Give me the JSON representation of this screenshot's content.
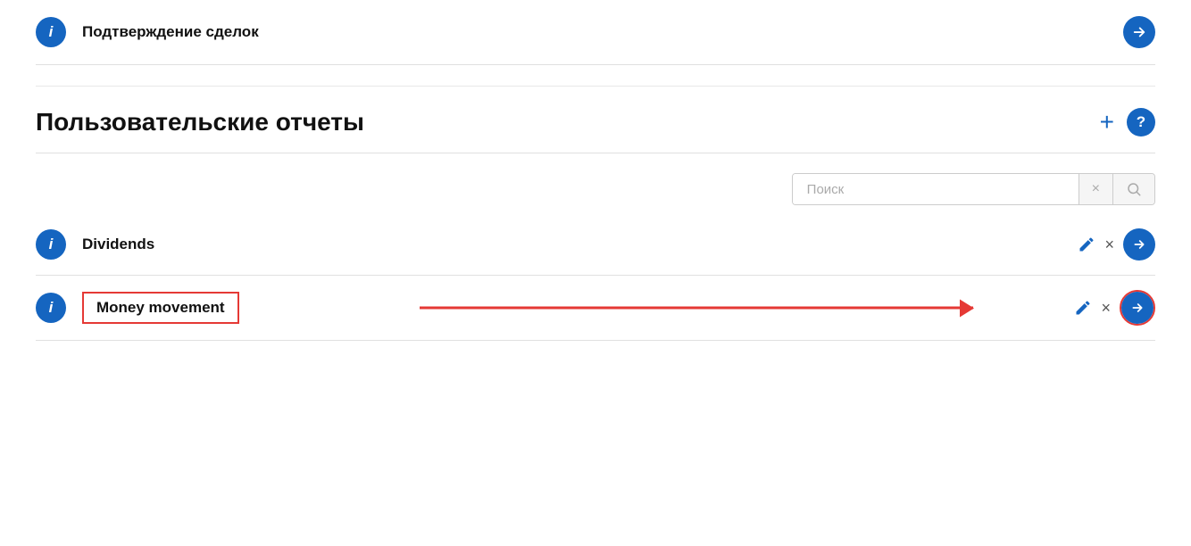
{
  "top": {
    "title": "Подтверждение сделок",
    "info_icon": "i",
    "go_icon": "→"
  },
  "section": {
    "title": "Пользовательские отчеты",
    "plus_label": "+",
    "help_label": "?"
  },
  "search": {
    "placeholder": "Поиск",
    "clear_icon": "×",
    "search_icon": "🔍"
  },
  "rows": [
    {
      "id": "dividends",
      "label": "Dividends",
      "info_icon": "i",
      "highlighted": false
    },
    {
      "id": "money-movement",
      "label": "Money movement",
      "info_icon": "i",
      "highlighted": true
    }
  ]
}
